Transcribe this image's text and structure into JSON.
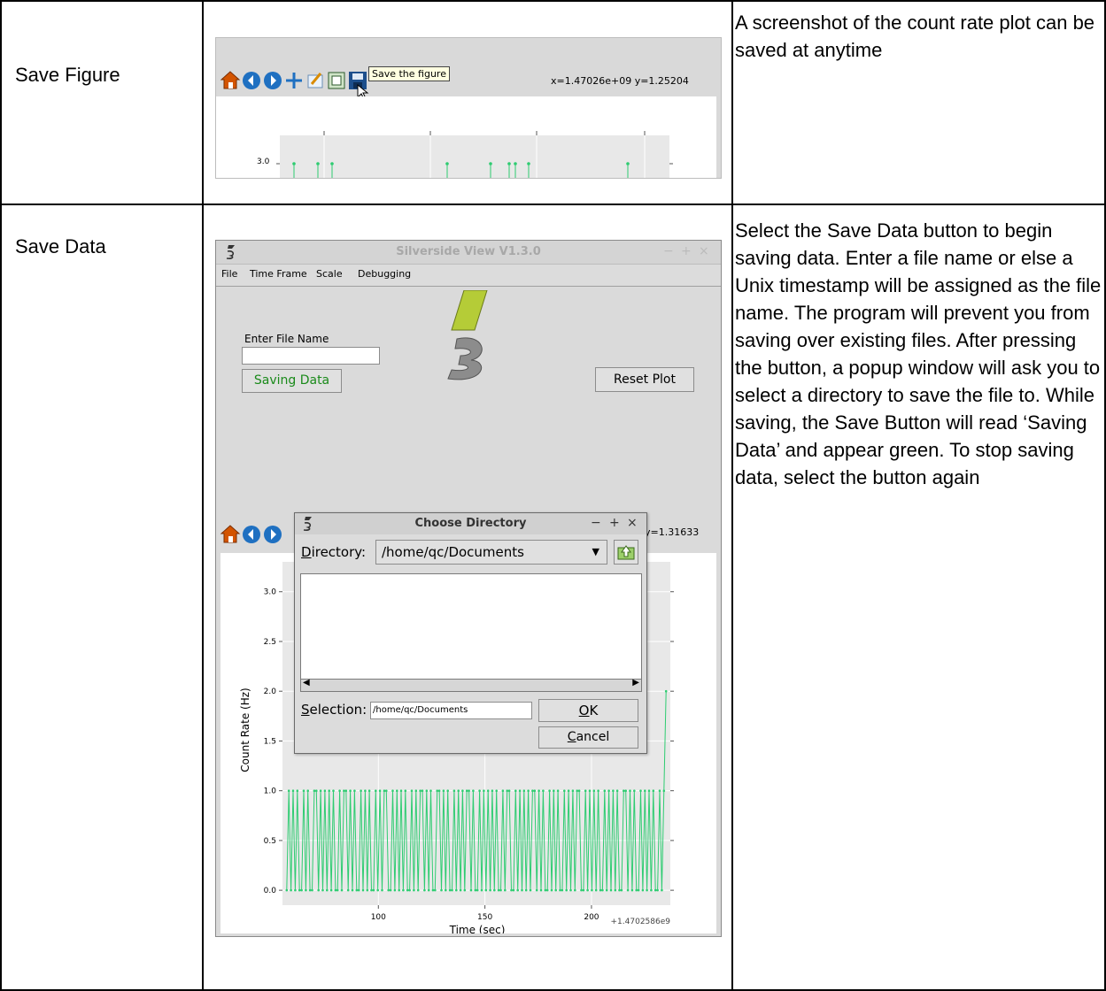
{
  "rows": [
    {
      "label": "Save Figure",
      "description": "A screenshot of the count rate plot can be saved at anytime"
    },
    {
      "label": "Save Data",
      "description": "Select the Save Data button to begin saving data. Enter a file name or else a Unix timestamp will be assigned as the file name. The program will prevent you from saving over existing files. After pressing the button, a popup window will ask you to select a directory to save the file to. While saving, the Save Button will read ‘Saving Data’ and appear green. To stop saving data, select the button again"
    }
  ],
  "figure_toolbar": {
    "tooltip": "Save the figure",
    "coords": "x=1.47026e+09  y=1.25204",
    "tick_label": "3.0",
    "icons": [
      "home-icon",
      "back-arrow-icon",
      "forward-arrow-icon",
      "pan-icon",
      "edit-axis-icon",
      "configure-subplots-icon",
      "save-floppy-icon"
    ]
  },
  "app": {
    "title": "Silverside View V1.3.0",
    "window_controls": [
      "−",
      "+",
      "×"
    ],
    "menu": [
      "File",
      "Time Frame",
      "Scale",
      "Debugging"
    ],
    "file_name_label": "Enter File Name",
    "file_name_value": "",
    "save_button": "Saving Data",
    "reset_button": "Reset Plot",
    "coords": "y=1.31633",
    "save_color": "#1a8a1a",
    "logo_green": "#b5cc37",
    "logo_gray": "#8c8c8c"
  },
  "dialog": {
    "title": "Choose Directory",
    "window_controls": [
      "−",
      "+",
      "×"
    ],
    "directory_label": "Directory:",
    "directory_value": "/home/qc/Documents",
    "selection_label": "Selection:",
    "selection_value": "/home/qc/Documents",
    "ok": "OK",
    "cancel": "Cancel"
  },
  "chart_data": {
    "type": "line",
    "xlabel": "Time (sec)",
    "ylabel": "Count Rate (Hz)",
    "x_offset_label": "+1.4702586e9",
    "xticks": [
      100,
      150,
      200
    ],
    "yticks": [
      "0.0",
      "0.5",
      "1.0",
      "1.5",
      "2.0",
      "2.5",
      "3.0"
    ],
    "xlim": [
      55,
      237
    ],
    "ylim": [
      -0.15,
      3.3
    ],
    "line_color": "#2ecc71",
    "series": [
      {
        "values": [
          0,
          1,
          0,
          1,
          0,
          1,
          0,
          0,
          1,
          0,
          1,
          0,
          0,
          1,
          1,
          0,
          1,
          0,
          1,
          0,
          1,
          0,
          1,
          0,
          0,
          1,
          0,
          1,
          1,
          0,
          1,
          0,
          1,
          0,
          0,
          1,
          0,
          1,
          0,
          1,
          0,
          0,
          1,
          0,
          1,
          0,
          1,
          1,
          0,
          0,
          1,
          0,
          1,
          0,
          1,
          0,
          1,
          0,
          0,
          1,
          0,
          1,
          0,
          1,
          1,
          0,
          1,
          0,
          1,
          0,
          0,
          1,
          1,
          0,
          1,
          0,
          1,
          0,
          0,
          1,
          0,
          1,
          0,
          1,
          0,
          1,
          1,
          0,
          1,
          0,
          0,
          1,
          0,
          1,
          0,
          1,
          0,
          1,
          0,
          1,
          0,
          0,
          1,
          0,
          1,
          1,
          0,
          0,
          1,
          0,
          1,
          0,
          1,
          0,
          1,
          0,
          1,
          1,
          0,
          1,
          0,
          1,
          0,
          0,
          1,
          0,
          1,
          0,
          1,
          0,
          0,
          1,
          0,
          1,
          0,
          1,
          0,
          1,
          1,
          0,
          0,
          1,
          0,
          1,
          0,
          1,
          0,
          1,
          0,
          0,
          1,
          0,
          1,
          0,
          1,
          0,
          1,
          0,
          0,
          1,
          1,
          0,
          1,
          0,
          1,
          0,
          0,
          1,
          0,
          1,
          0,
          1,
          0,
          1,
          0,
          0,
          1,
          0,
          1,
          2
        ]
      }
    ]
  }
}
